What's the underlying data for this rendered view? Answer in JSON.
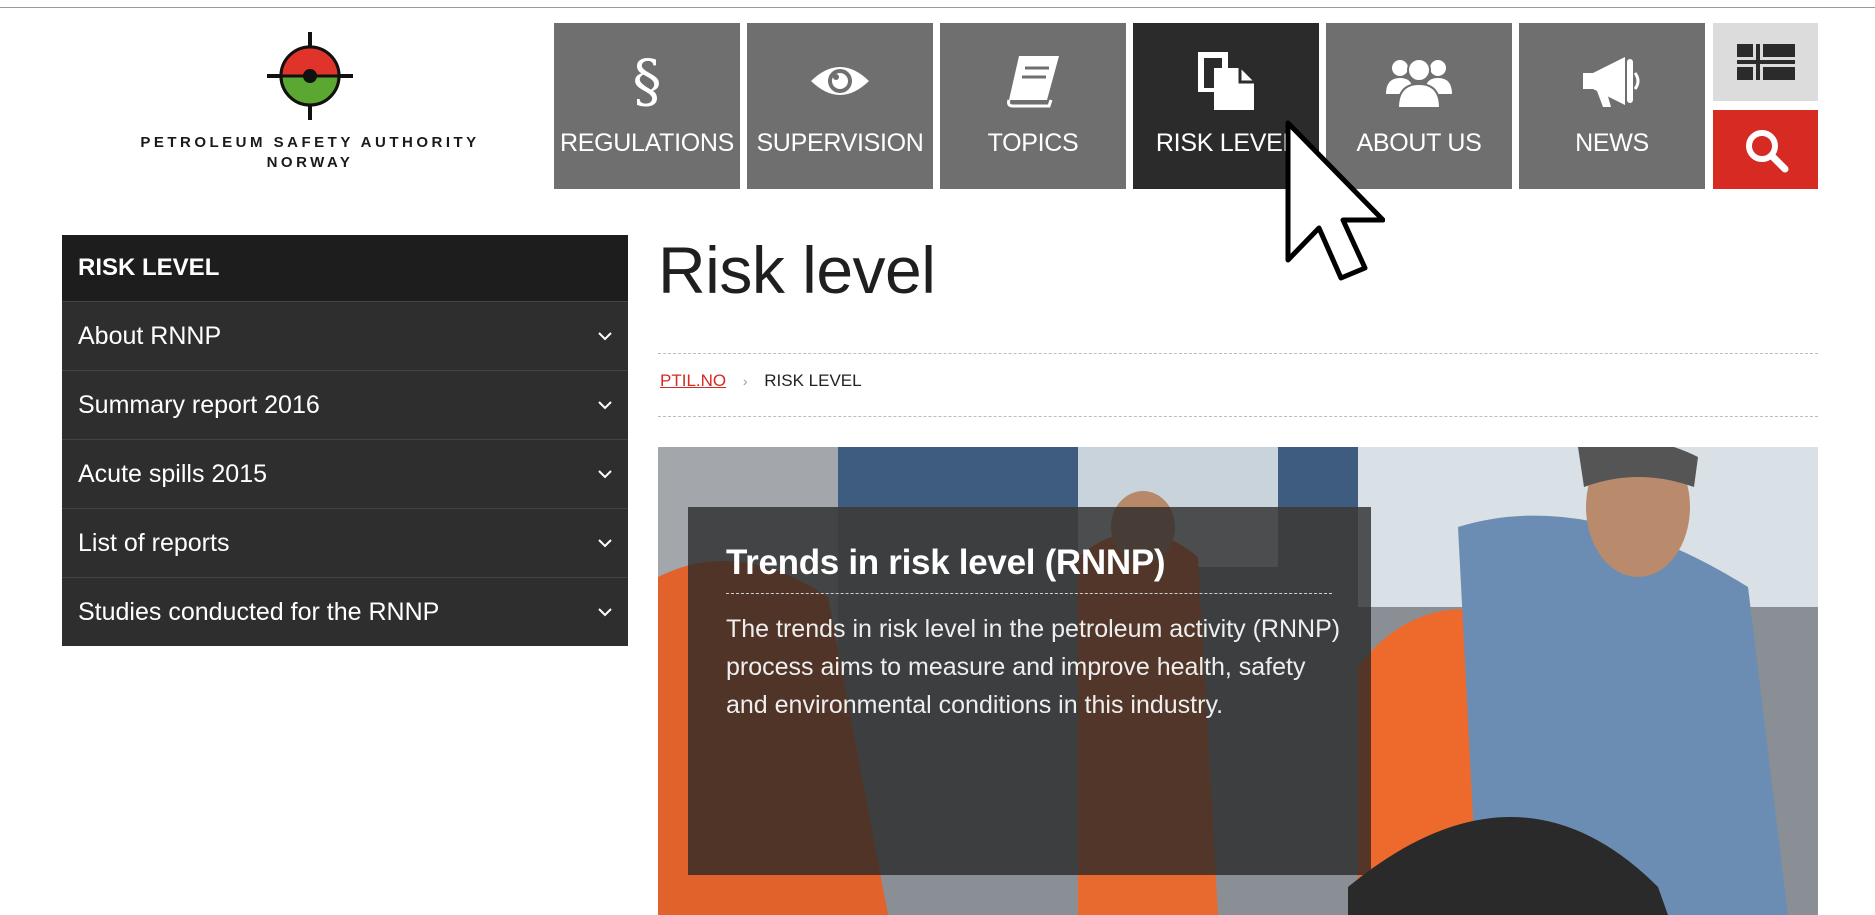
{
  "logo": {
    "line1": "PETROLEUM SAFETY AUTHORITY",
    "line2": "NORWAY"
  },
  "nav": {
    "items": [
      {
        "label": "REGULATIONS",
        "icon": "paragraph-icon"
      },
      {
        "label": "SUPERVISION",
        "icon": "eye-icon"
      },
      {
        "label": "TOPICS",
        "icon": "book-icon"
      },
      {
        "label": "RISK LEVEL",
        "icon": "document-icon",
        "active": true
      },
      {
        "label": "ABOUT US",
        "icon": "group-icon"
      },
      {
        "label": "NEWS",
        "icon": "megaphone-icon"
      }
    ],
    "language_icon": "norwegian-flag-icon",
    "search_icon": "search-icon"
  },
  "sidebar": {
    "header": "RISK LEVEL",
    "items": [
      {
        "label": "About RNNP"
      },
      {
        "label": "Summary report 2016"
      },
      {
        "label": "Acute spills 2015"
      },
      {
        "label": "List of reports"
      },
      {
        "label": "Studies conducted for the RNNP"
      }
    ]
  },
  "main": {
    "title": "Risk level",
    "breadcrumb": {
      "home": "PTIL.NO",
      "current": "RISK LEVEL"
    },
    "hero": {
      "title": "Trends in risk level (RNNP)",
      "text": "The trends in risk level in the petroleum activity (RNNP) process aims to measure and improve health, safety and environmental conditions in this industry."
    }
  },
  "colors": {
    "accent_red": "#d62a22",
    "nav_gray": "#6f6f6f",
    "nav_active": "#2b2b2b",
    "sidebar_bg": "#2e2e2e",
    "logo_green": "#5aa832",
    "logo_red": "#e0342a"
  }
}
